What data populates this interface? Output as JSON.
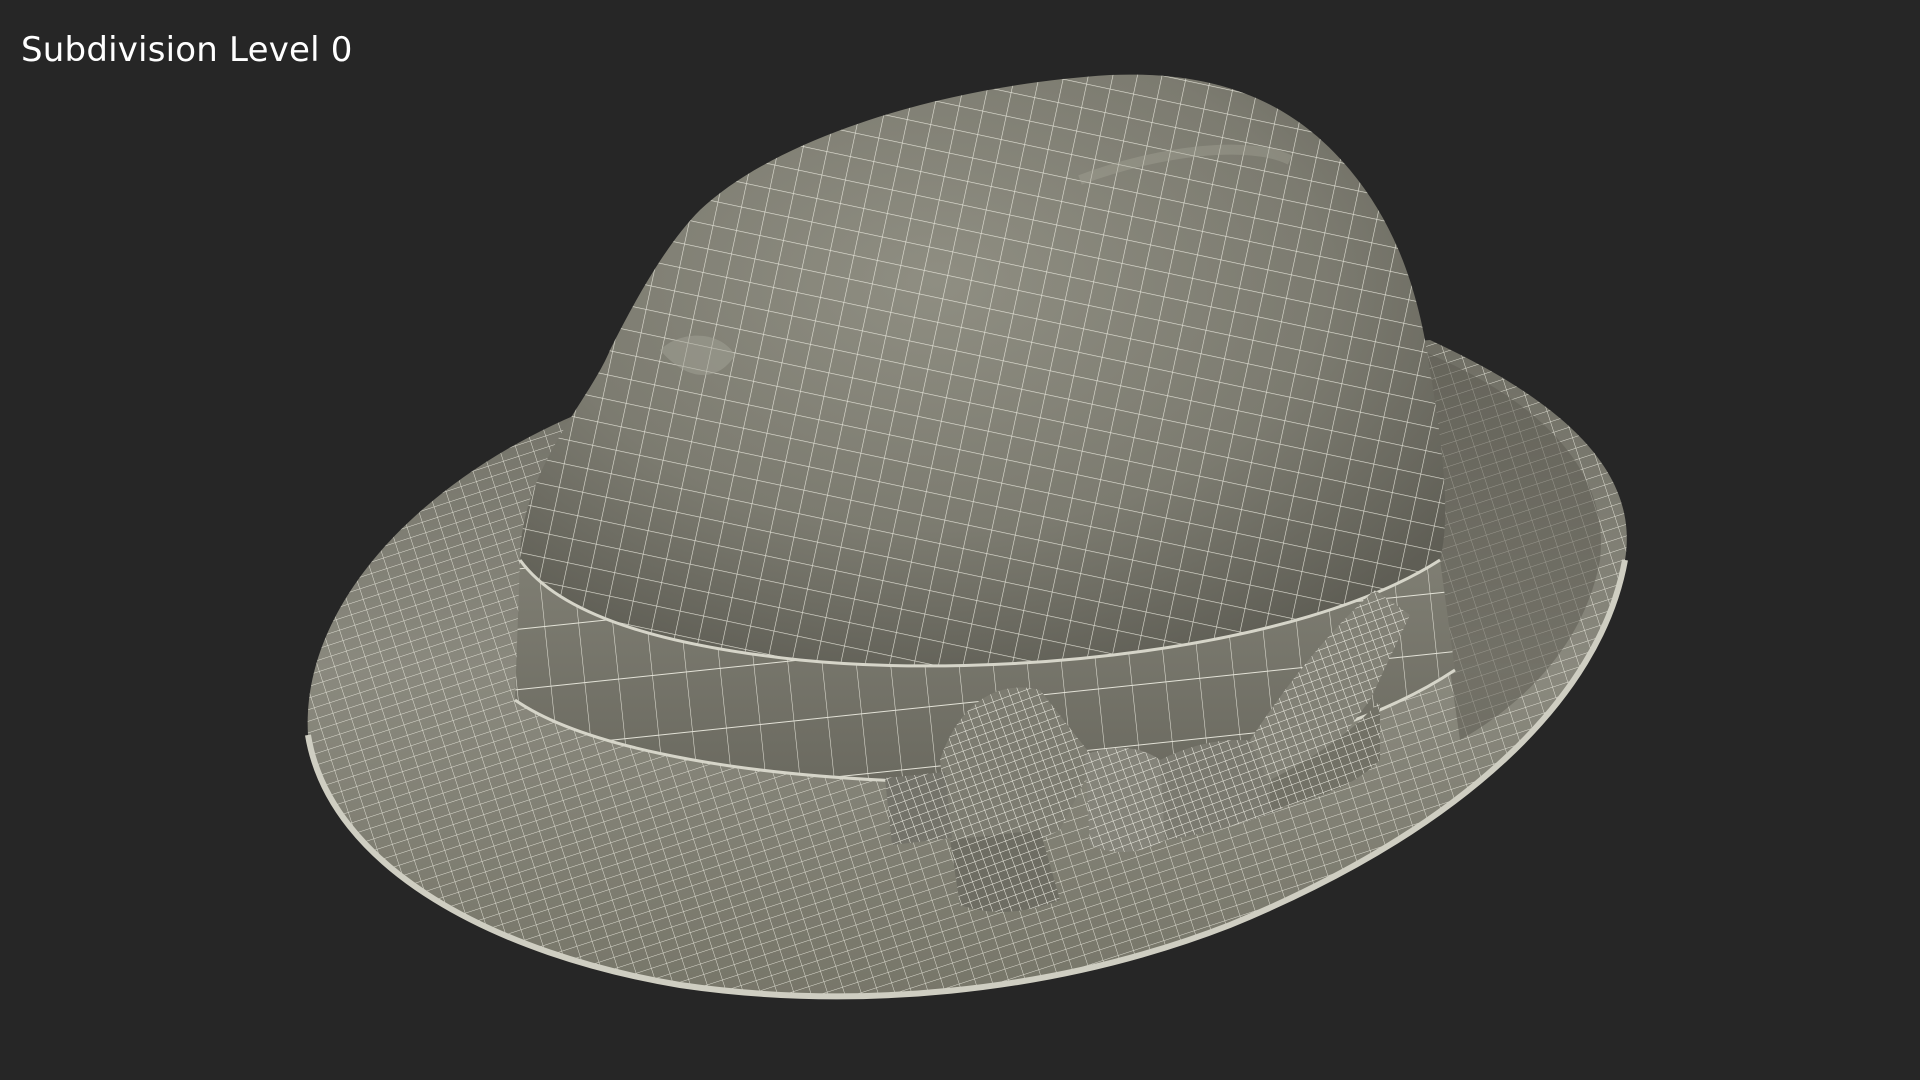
{
  "viewport": {
    "label": "Subdivision Level 0",
    "background_color": "#262626"
  },
  "model": {
    "subject": "hat-wireframe",
    "surface_color": "#8a897d",
    "wire_color": "#f2f1e6"
  }
}
